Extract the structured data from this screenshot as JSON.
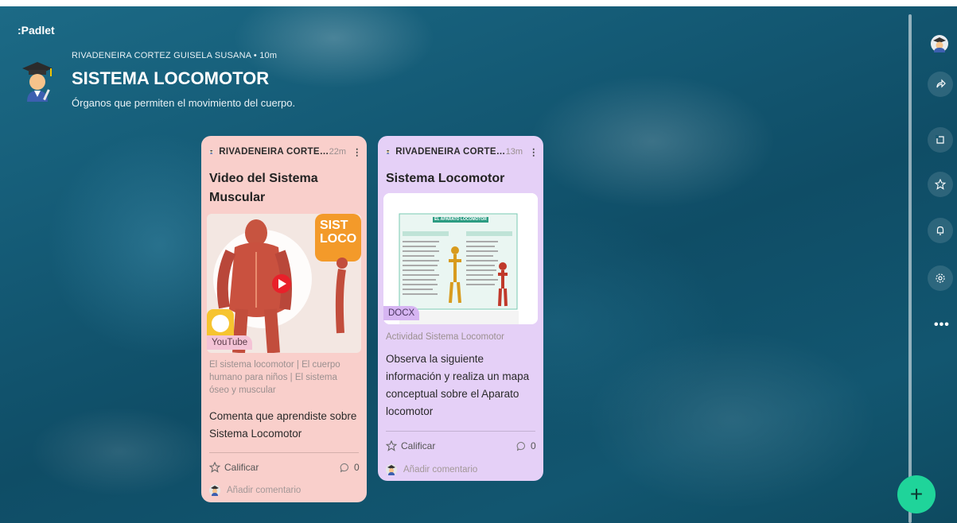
{
  "app": {
    "brand": ":Padlet"
  },
  "header": {
    "author_line": "RIVADENEIRA CORTEZ GUISELA SUSANA • 10m",
    "title": "SISTEMA LOCOMOTOR",
    "subtitle": "Órganos que permiten el movimiento del cuerpo."
  },
  "posts": [
    {
      "author": "RIVADENEIRA CORTE…",
      "time": "22m",
      "title": "Video del Sistema Muscular",
      "attachment_badge": "YouTube",
      "thumb_text": "SIST LOCO",
      "attachment_caption": "El sistema locomotor | El cuerpo humano para niños | El sistema óseo y muscular",
      "body": "Comenta que aprendiste sobre Sistema Locomotor",
      "rate_label": "Calificar",
      "comment_count": "0",
      "add_comment": "Añadir comentario"
    },
    {
      "author": "RIVADENEIRA CORTE…",
      "time": "13m",
      "title": "Sistema Locomotor",
      "attachment_badge": "DOCX",
      "doc_heading": "EL APARATO LOCOMOTOR",
      "attachment_caption": "Actividad Sistema Locomotor",
      "body": "Observa la siguiente información y realiza un mapa conceptual sobre el Aparato locomotor",
      "rate_label": "Calificar",
      "comment_count": "0",
      "add_comment": "Añadir comentario"
    }
  ],
  "sidebar": {
    "icons": [
      "remake-icon",
      "share-icon",
      "bookmark-icon",
      "notifications-icon",
      "settings-icon",
      "more-icon"
    ],
    "more_label": "•••"
  },
  "fab": {
    "label": "+"
  },
  "colors": {
    "card1_bg": "#f9cfcb",
    "card2_bg": "#e5d0f7",
    "fab_bg": "#1fd49a",
    "ocean": "#145a75"
  }
}
